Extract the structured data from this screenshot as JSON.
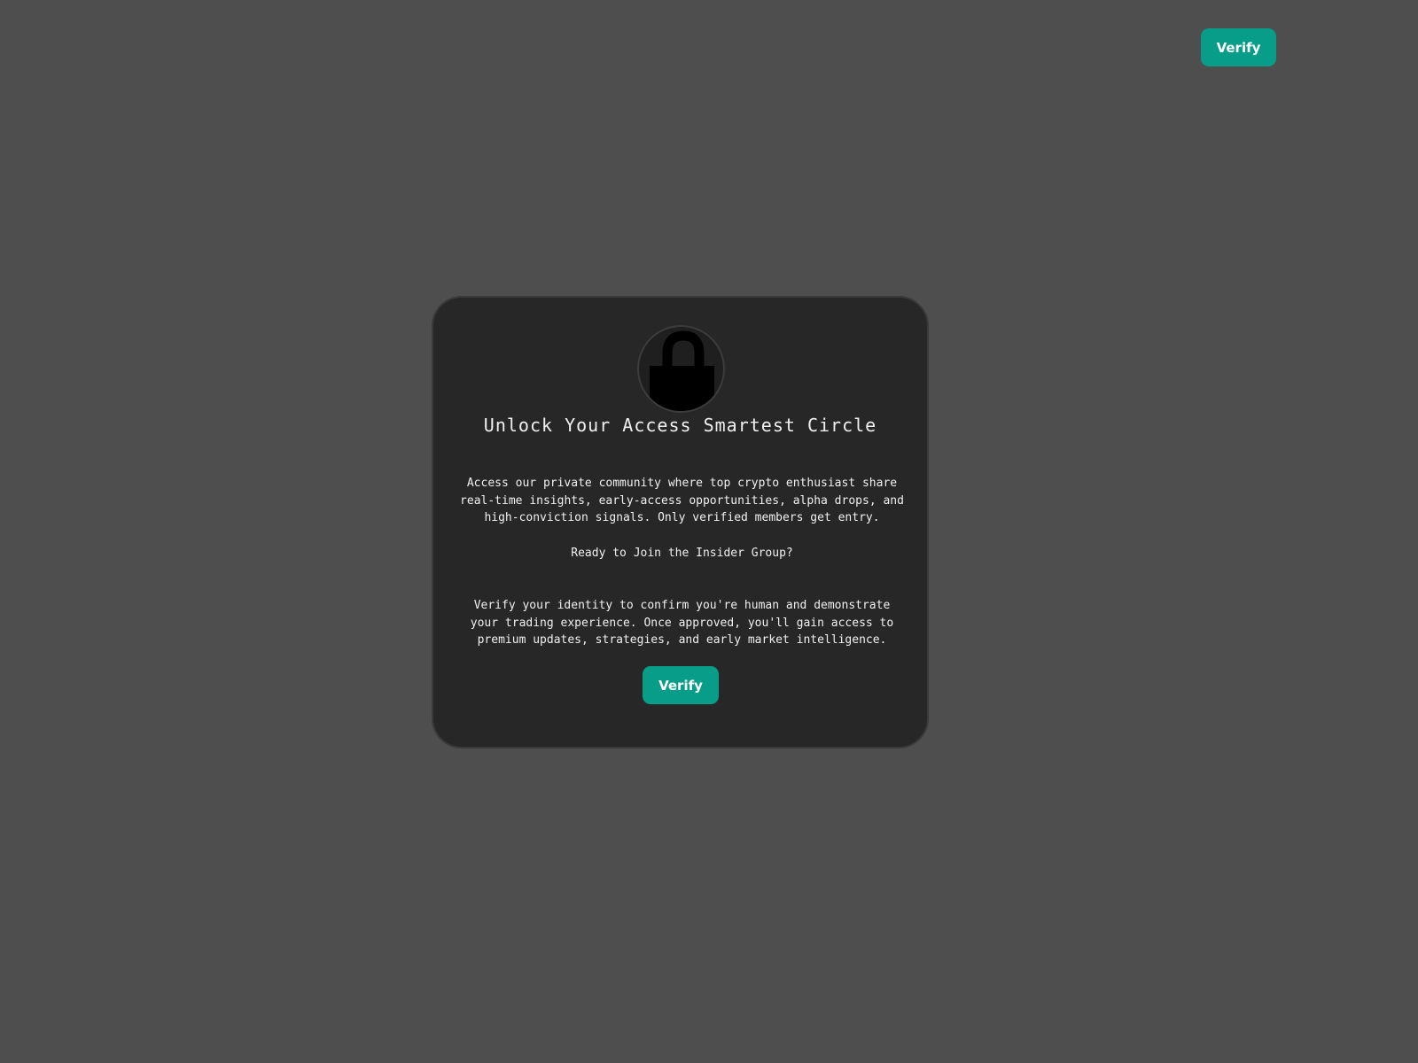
{
  "header": {
    "verify_label": "Verify"
  },
  "card": {
    "icon": "unlocked-padlock-icon",
    "title": "Unlock Your Access Smartest Circle",
    "intro": "Access our private community where top crypto enthusiast share real-time insights, early-access opportunities, alpha drops, and high-conviction signals. Only verified members get entry.",
    "ready_prompt": "Ready to Join the Insider Group?",
    "verify_text": "Verify your identity to confirm you're human and demonstrate your trading experience. Once approved, you'll gain access to premium updates, strategies, and early market intelligence.",
    "verify_label": "Verify"
  },
  "colors": {
    "page_background": "#4e4e4e",
    "card_background": "#272727",
    "accent": "#079d88",
    "text": "#f0f0f0"
  }
}
